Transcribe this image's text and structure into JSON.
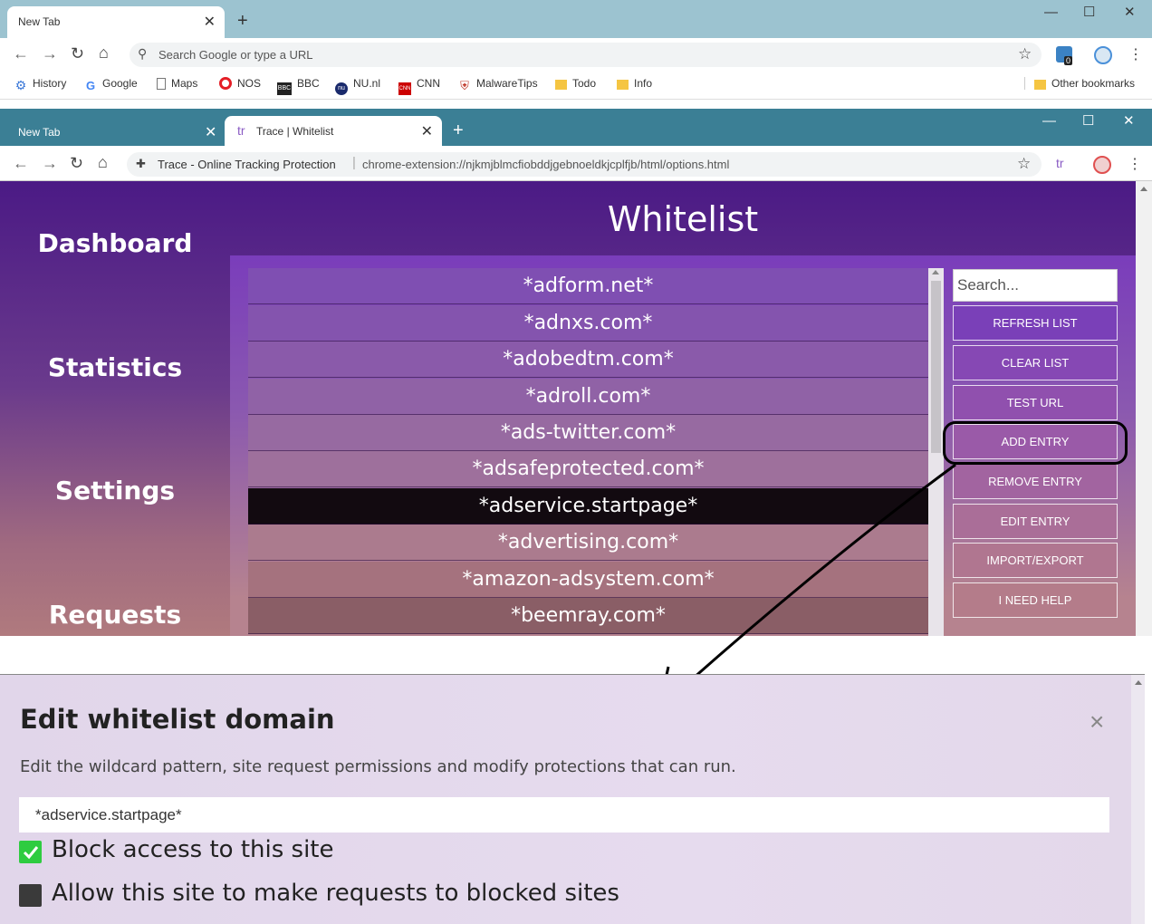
{
  "window1": {
    "tab_title": "New Tab",
    "omnibox_placeholder": "Search Google or type a URL",
    "bookmarks": [
      {
        "label": "History"
      },
      {
        "label": "Google"
      },
      {
        "label": "Maps"
      },
      {
        "label": "NOS"
      },
      {
        "label": "BBC"
      },
      {
        "label": "NU.nl"
      },
      {
        "label": "CNN"
      },
      {
        "label": "MalwareTips"
      },
      {
        "label": "Todo"
      },
      {
        "label": "Info"
      }
    ],
    "other_bookmarks": "Other bookmarks",
    "ext_badge": "0"
  },
  "window2": {
    "tab1_title": "New Tab",
    "tab2_title": "Trace | Whitelist",
    "tab2_favicon": "tr",
    "site_name": "Trace - Online Tracking Protection",
    "url": "chrome-extension://njkmjblmcfiobddjgebnoeldkjcplfjb/html/options.html",
    "ext_icon": "tr"
  },
  "sidebar": {
    "items": [
      "Dashboard",
      "Statistics",
      "Settings",
      "Requests"
    ]
  },
  "whitelist": {
    "title": "Whitelist",
    "entries": [
      "*adform.net*",
      "*adnxs.com*",
      "*adobedtm.com*",
      "*adroll.com*",
      "*ads-twitter.com*",
      "*adsafeprotected.com*",
      "*adservice.startpage*",
      "*advertising.com*",
      "*amazon-adsystem.com*",
      "*beemray.com*"
    ],
    "selected_index": 6,
    "search_placeholder": "Search...",
    "buttons": [
      "REFRESH LIST",
      "CLEAR LIST",
      "TEST URL",
      "ADD ENTRY",
      "REMOVE ENTRY",
      "EDIT ENTRY",
      "IMPORT/EXPORT",
      "I NEED HELP"
    ]
  },
  "modal": {
    "title": "Edit whitelist domain",
    "close": "×",
    "description": "Edit the wildcard pattern, site request permissions and modify protections that can run.",
    "pattern_value": "*adservice.startpage*",
    "options": [
      {
        "label": "Block access to this site",
        "checked": true
      },
      {
        "label": "Allow this site to make requests to blocked sites",
        "checked": false
      }
    ]
  },
  "colors": {
    "accent_purple": "#4b1a85",
    "selected_row": "#120a10",
    "checkbox_on": "#2ecc40"
  }
}
